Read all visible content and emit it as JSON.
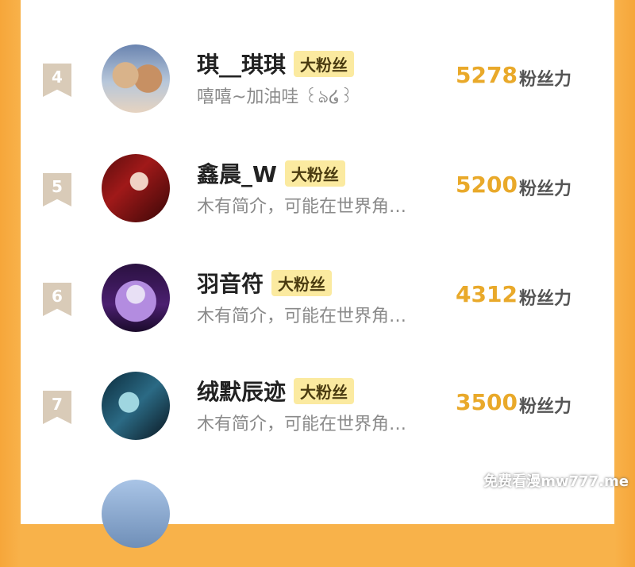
{
  "rows": [
    {
      "rank": "4",
      "name": "琪__琪琪",
      "badge": "大粉丝",
      "bio": "嘻嘻~加油哇 ꒰ঌ໒꒱",
      "count": "5278",
      "count_unit": "粉丝力",
      "avatar": "teddy-bears-avatar"
    },
    {
      "rank": "5",
      "name": "鑫晨_W",
      "badge": "大粉丝",
      "bio": "木有简介，可能在世界角…",
      "count": "5200",
      "count_unit": "粉丝力",
      "avatar": "anime-red-avatar"
    },
    {
      "rank": "6",
      "name": "羽音符",
      "badge": "大粉丝",
      "bio": "木有简介，可能在世界角…",
      "count": "4312",
      "count_unit": "粉丝力",
      "avatar": "anime-purple-avatar"
    },
    {
      "rank": "7",
      "name": "绒默辰迹",
      "badge": "大粉丝",
      "bio": "木有简介，可能在世界角…",
      "count": "3500",
      "count_unit": "粉丝力",
      "avatar": "blue-character-avatar"
    }
  ],
  "watermark": "免费看漫mw777.me",
  "colors": {
    "accent": "#e9a92a",
    "badge_bg": "#fbeaa0",
    "frame": "#f8b24a"
  }
}
